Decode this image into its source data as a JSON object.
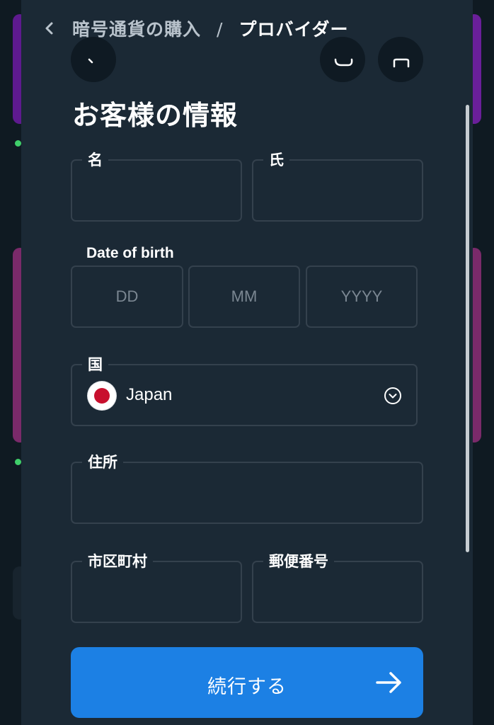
{
  "header": {
    "back_label": "暗号通貨の購入",
    "separator": "/",
    "current": "プロバイダー"
  },
  "form": {
    "title": "お客様の情報",
    "first_name": {
      "label": "名",
      "value": ""
    },
    "last_name": {
      "label": "氏",
      "value": ""
    },
    "dob": {
      "label": "Date of birth",
      "day_placeholder": "DD",
      "month_placeholder": "MM",
      "year_placeholder": "YYYY"
    },
    "country": {
      "label": "国",
      "value": "Japan",
      "flag": "japan-flag"
    },
    "address": {
      "label": "住所",
      "value": ""
    },
    "city": {
      "label": "市区町村",
      "value": ""
    },
    "postal_code": {
      "label": "郵便番号",
      "value": ""
    },
    "continue_label": "続行する"
  },
  "colors": {
    "panel": "#1b2935",
    "field_border": "#34414d",
    "accent": "#1c80e4",
    "flag_red": "#c8102e"
  }
}
